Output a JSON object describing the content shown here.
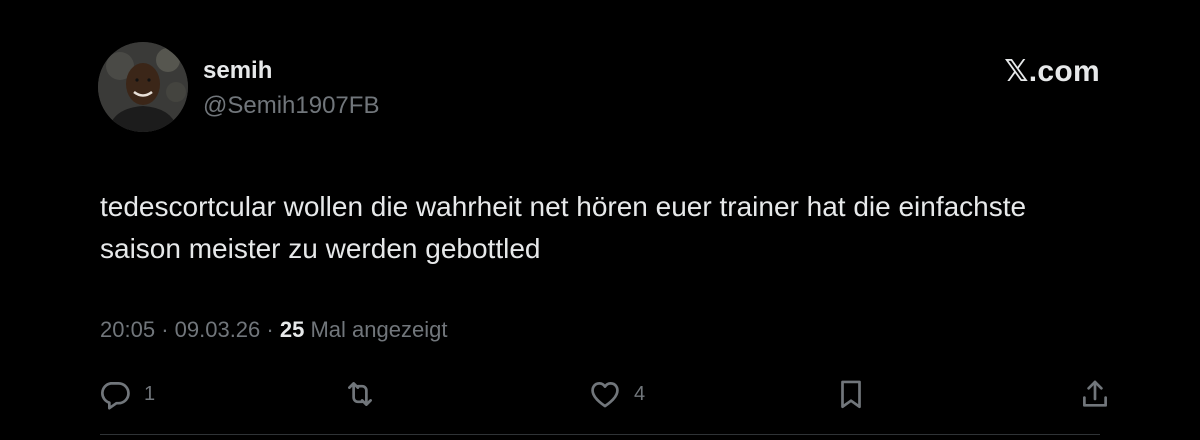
{
  "author": {
    "display_name": "semih",
    "handle": "@Semih1907FB"
  },
  "brand": "𝕏.com",
  "tweet": {
    "text": "tedescortcular wollen die wahrheit net hören euer trainer hat die einfachste saison meister zu werden gebottled",
    "time": "20:05",
    "date": "09.03.26",
    "separator": "·",
    "views_count": "25",
    "views_label": "Mal angezeigt"
  },
  "actions": {
    "reply": {
      "icon": "reply-icon",
      "count": "1"
    },
    "retweet": {
      "icon": "retweet-icon"
    },
    "like": {
      "icon": "heart-icon",
      "count": "4"
    },
    "bookmark": {
      "icon": "bookmark-icon"
    },
    "share": {
      "icon": "share-icon"
    }
  },
  "colors": {
    "background": "#000000",
    "primary_text": "#e7e9ea",
    "secondary_text": "#71767b",
    "divider": "#2f3336"
  }
}
